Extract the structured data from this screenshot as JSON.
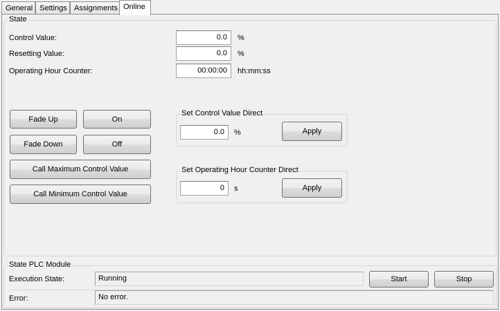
{
  "tabs": [
    {
      "label": "General"
    },
    {
      "label": "Settings"
    },
    {
      "label": "Assignments"
    },
    {
      "label": "Online"
    }
  ],
  "state": {
    "legend": "State",
    "control_value_label": "Control Value:",
    "control_value": "0.0",
    "control_value_unit": "%",
    "resetting_value_label": "Resetting Value:",
    "resetting_value": "0.0",
    "resetting_value_unit": "%",
    "operating_hour_label": "Operating Hour Counter:",
    "operating_hour_value": "00:00:00",
    "operating_hour_unit": "hh:mm:ss"
  },
  "buttons": {
    "fade_up": "Fade Up",
    "on": "On",
    "fade_down": "Fade Down",
    "off": "Off",
    "call_max": "Call Maximum Control Value",
    "call_min": "Call Minimum Control Value"
  },
  "set_control": {
    "legend": "Set Control Value Direct",
    "value": "0.0",
    "unit": "%",
    "apply": "Apply"
  },
  "set_hour": {
    "legend": "Set Operating Hour Counter Direct",
    "value": "0",
    "unit": "s",
    "apply": "Apply"
  },
  "plc": {
    "legend": "State PLC Module",
    "execution_label": "Execution State:",
    "execution_value": "Running",
    "error_label": "Error:",
    "error_value": "No error.",
    "start": "Start",
    "stop": "Stop"
  }
}
